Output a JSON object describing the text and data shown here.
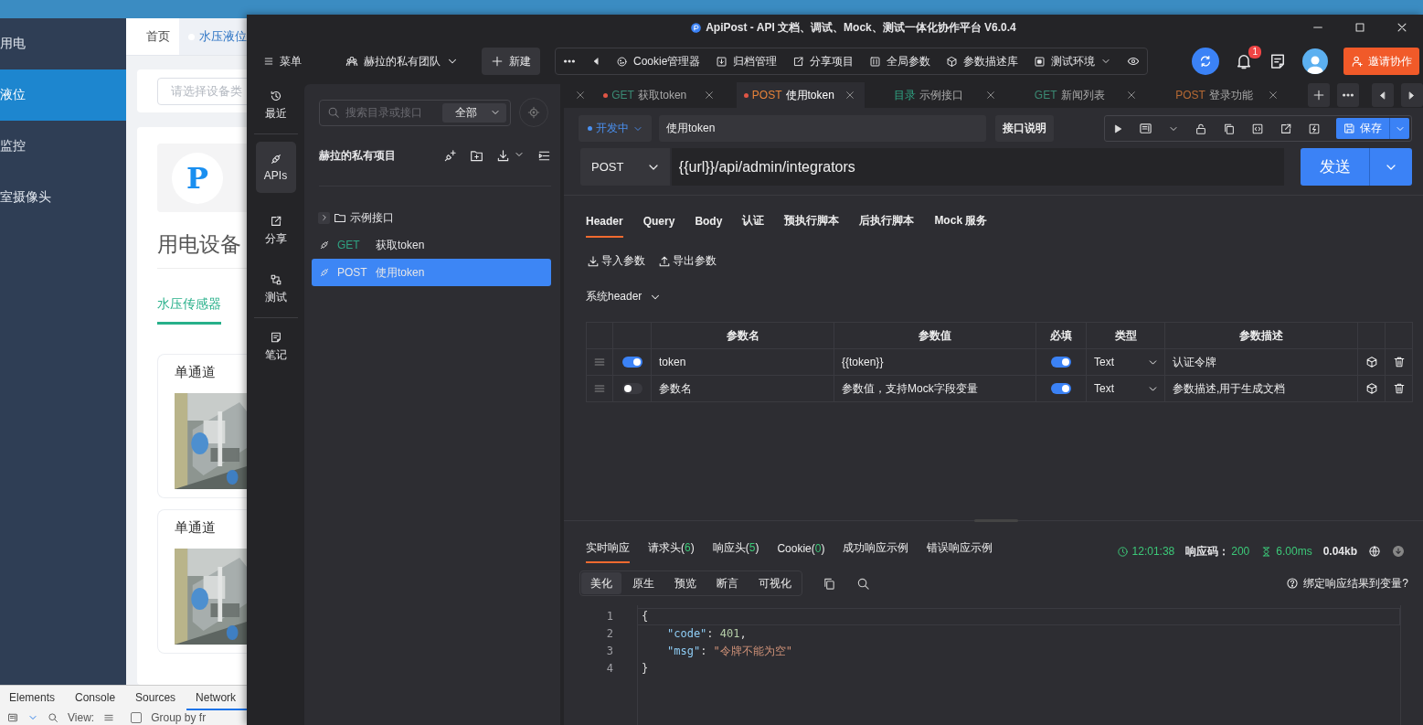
{
  "background_app": {
    "sidebar": [
      {
        "label": "用电",
        "selected": false
      },
      {
        "label": "液位",
        "selected": true
      },
      {
        "label": "监控",
        "selected": false
      },
      {
        "label": "室摄像头",
        "selected": false
      }
    ],
    "tabs": [
      {
        "label": "首页",
        "selected": false
      },
      {
        "label": "水压液位",
        "selected": true
      }
    ],
    "filter": {
      "placeholder": "请选择设备类"
    },
    "logo_letter": "P",
    "title": "用电设备",
    "category_tab": {
      "label": "水压传感器",
      "selected": true
    },
    "cards": [
      {
        "title": "单通道"
      },
      {
        "title": "单通道"
      }
    ],
    "devtools": {
      "tabs": [
        {
          "label": "Elements",
          "selected": false
        },
        {
          "label": "Console",
          "selected": false
        },
        {
          "label": "Sources",
          "selected": false
        },
        {
          "label": "Network",
          "selected": true
        }
      ],
      "view_label": "View:",
      "group_label": "Group by fr",
      "group_checked": false
    }
  },
  "window": {
    "title": "ApiPost - API 文档、调试、Mock、测试一体化协作平台 V6.0.4"
  },
  "toolbar": {
    "menu": "菜单",
    "team": "赫拉的私有团队",
    "new_button": "新建",
    "tools": [
      {
        "kind": "cookie",
        "label": "Cookie管理器",
        "dropdown": false
      },
      {
        "kind": "archive",
        "label": "归档管理",
        "dropdown": false
      },
      {
        "kind": "share",
        "label": "分享项目",
        "dropdown": false
      },
      {
        "kind": "params",
        "label": "全局参数",
        "dropdown": false
      },
      {
        "kind": "cube",
        "label": "参数描述库",
        "dropdown": false
      },
      {
        "kind": "env",
        "label": "测试环境",
        "dropdown": true
      }
    ],
    "notifications": "1",
    "invite": "邀请协作"
  },
  "rail": [
    {
      "kind": "history",
      "label": "最近",
      "selected": false
    },
    {
      "kind": "plug",
      "label": "APIs",
      "selected": true
    },
    {
      "kind": "share",
      "label": "分享",
      "selected": false
    },
    {
      "kind": "flow",
      "label": "测试",
      "selected": false
    },
    {
      "kind": "note",
      "label": "笔记",
      "selected": false
    }
  ],
  "tree": {
    "search_placeholder": "搜索目录或接口",
    "filter": "全部",
    "project": "赫拉的私有项目",
    "items": [
      {
        "kind": "folder",
        "title": "示例接口",
        "expanded": false,
        "selected": false
      },
      {
        "kind": "api",
        "method": "GET",
        "color": "#2fa383",
        "title": "获取token",
        "selected": false
      },
      {
        "kind": "api",
        "method": "POST",
        "title": "使用token",
        "selected": true
      }
    ]
  },
  "tabs": [
    {
      "method": "GET",
      "color": "#3b8a74",
      "title": "获取token",
      "unsaved": true,
      "selected": false
    },
    {
      "method": "POST",
      "color": "#e8833a",
      "title": "使用token",
      "unsaved": true,
      "selected": true
    },
    {
      "method": "目录",
      "color": "#2fa383",
      "title": "示例接口",
      "unsaved": false,
      "selected": false
    },
    {
      "method": "GET",
      "color": "#3b8a74",
      "title": "新闻列表",
      "unsaved": false,
      "selected": false
    },
    {
      "method": "POST",
      "color": "#b86a34",
      "title": "登录功能",
      "unsaved": false,
      "selected": false
    }
  ],
  "request": {
    "status": "开发中",
    "name": "使用token",
    "doc_button": "接口说明",
    "save": "保存",
    "method": "POST",
    "url": "{{url}}/api/admin/integrators",
    "send": "发送"
  },
  "request_tabs": [
    {
      "label": "Header",
      "selected": true
    },
    {
      "label": "Query",
      "selected": false
    },
    {
      "label": "Body",
      "selected": false
    },
    {
      "label": "认证",
      "selected": false
    },
    {
      "label": "预执行脚本",
      "selected": false
    },
    {
      "label": "后执行脚本",
      "selected": false
    },
    {
      "label": "Mock 服务",
      "selected": false
    }
  ],
  "import_button": "导入参数",
  "export_button": "导出参数",
  "system_header": "系统header",
  "params_table": {
    "columns": [
      "参数名",
      "参数值",
      "必填",
      "类型",
      "参数描述"
    ],
    "rows": [
      {
        "enabled": true,
        "name": "token",
        "value": "{{token}}",
        "required": true,
        "type": "Text",
        "description": "认证令牌"
      },
      {
        "enabled": false,
        "name_placeholder": "参数名",
        "value_placeholder": "参数值，支持Mock字段变量",
        "required": true,
        "type": "Text",
        "description_placeholder": "参数描述,用于生成文档"
      }
    ]
  },
  "response": {
    "tabs": [
      {
        "label": "实时响应",
        "selected": true
      },
      {
        "label": "请求头(",
        "count": "6",
        "suffix": ")",
        "selected": false
      },
      {
        "label": "响应头(",
        "count": "5",
        "suffix": ")",
        "selected": false
      },
      {
        "label": "Cookie(",
        "count": "0",
        "suffix": ")",
        "selected": false
      },
      {
        "label": "成功响应示例",
        "selected": false
      },
      {
        "label": "错误响应示例",
        "selected": false
      }
    ],
    "time": "12:01:38",
    "status_label": "响应码：",
    "status": "200",
    "duration": "6.00ms",
    "size": "0.04kb",
    "views": [
      {
        "label": "美化",
        "selected": true
      },
      {
        "label": "原生",
        "selected": false
      },
      {
        "label": "预览",
        "selected": false
      },
      {
        "label": "断言",
        "selected": false
      },
      {
        "label": "可视化",
        "selected": false
      }
    ],
    "bind_label": "绑定响应结果到变量?",
    "lines": [
      {
        "number": "1",
        "nested": false,
        "tokens": [
          {
            "kind": "punct",
            "text": "{"
          }
        ]
      },
      {
        "number": "2",
        "nested": true,
        "tokens": [
          {
            "kind": "key",
            "text": "\"code\""
          },
          {
            "kind": "punct",
            "text": ": "
          },
          {
            "kind": "number",
            "text": "401"
          },
          {
            "kind": "punct",
            "text": ","
          }
        ]
      },
      {
        "number": "3",
        "nested": true,
        "tokens": [
          {
            "kind": "key",
            "text": "\"msg\""
          },
          {
            "kind": "punct",
            "text": ": "
          },
          {
            "kind": "string",
            "text": "\"令牌不能为空\""
          }
        ]
      },
      {
        "number": "4",
        "nested": false,
        "tokens": [
          {
            "kind": "punct",
            "text": "}"
          }
        ]
      }
    ]
  }
}
